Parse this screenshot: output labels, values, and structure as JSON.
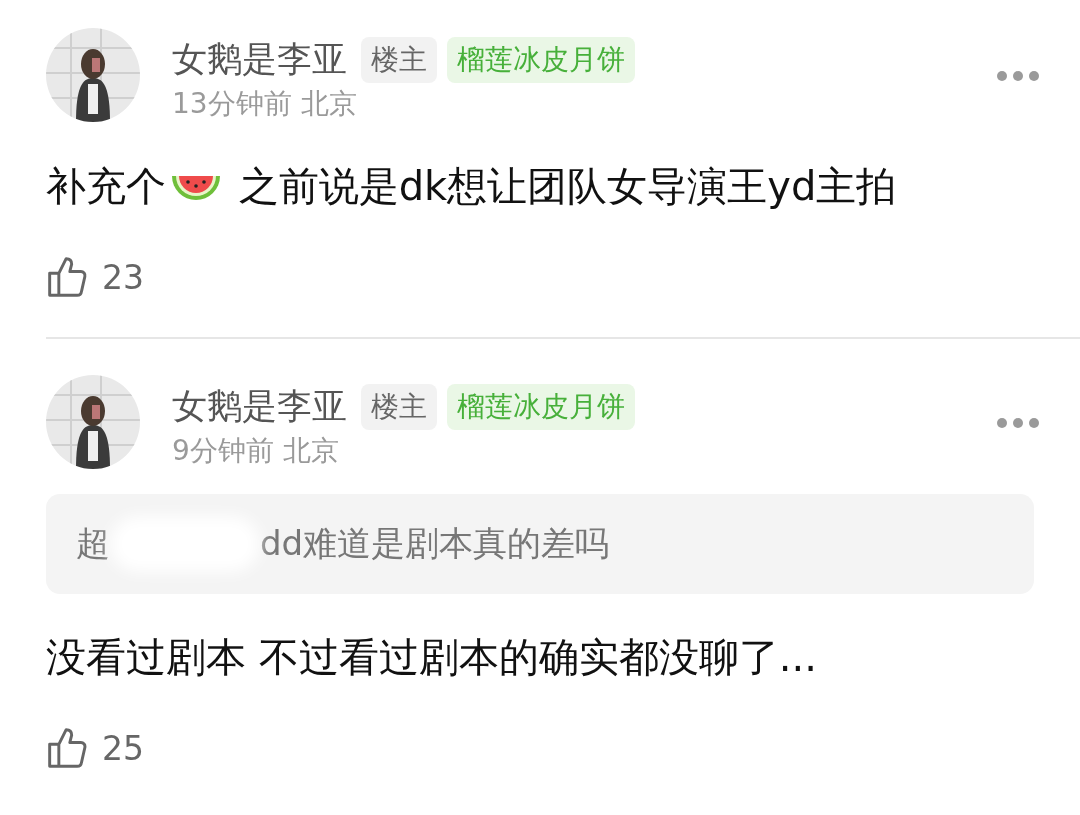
{
  "comments": [
    {
      "author": "女鹅是李亚",
      "tags": [
        {
          "label": "楼主",
          "kind": "role"
        },
        {
          "label": "榴莲冰皮月饼",
          "kind": "medal"
        }
      ],
      "time": "13分钟前 北京",
      "body_before": "补充个",
      "watermelon_emoji": true,
      "body_after": " 之前说是dk想让团队女导演王yd主拍",
      "likes": "23"
    },
    {
      "author": "女鹅是李亚",
      "tags": [
        {
          "label": "楼主",
          "kind": "role"
        },
        {
          "label": "榴莲冰皮月饼",
          "kind": "medal"
        }
      ],
      "time": "9分钟前 北京",
      "quote": {
        "start": "超",
        "redacted": true,
        "rest": "dd难道是剧本真的差吗"
      },
      "body_before": "没看过剧本 不过看过剧本的确实都没聊了...",
      "likes": "25"
    }
  ]
}
